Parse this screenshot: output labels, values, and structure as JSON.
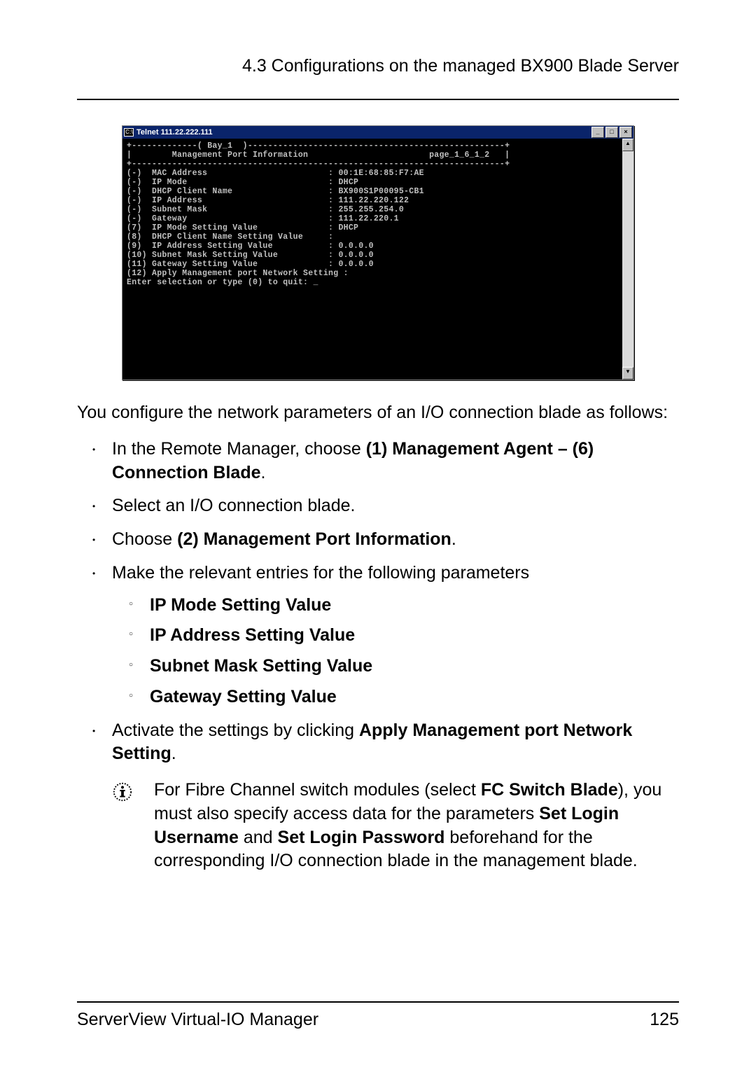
{
  "header": {
    "section": "4.3 Configurations on the managed BX900 Blade Server"
  },
  "telnet": {
    "title": "Telnet 111.22.222.111",
    "sysicon_label": "C:\\",
    "min_label": "_",
    "max_label": "□",
    "close_label": "×",
    "scroll_up": "▲",
    "scroll_down": "▼",
    "content": "+-------------( Bay_1  )---------------------------------------------------+\n|        Management Port Information                        page_1_6_1_2   |\n+--------------------------------------------------------------------------+\n(-)  MAC Address                        : 00:1E:68:85:F7:AE\n(-)  IP Mode                            : DHCP\n(-)  DHCP Client Name                   : BX900S1P00095-CB1\n(-)  IP Address                         : 111.22.220.122\n(-)  Subnet Mask                        : 255.255.254.0\n(-)  Gateway                            : 111.22.220.1\n(7)  IP Mode Setting Value              : DHCP\n(8)  DHCP Client Name Setting Value     :\n(9)  IP Address Setting Value           : 0.0.0.0\n(10) Subnet Mask Setting Value          : 0.0.0.0\n(11) Gateway Setting Value              : 0.0.0.0\n(12) Apply Management port Network Setting :\nEnter selection or type (0) to quit: _"
  },
  "chart_data": {
    "type": "table",
    "title": "Management Port Information",
    "page_ref": "page_1_6_1_2",
    "bay": "Bay_1",
    "rows": [
      {
        "key": "(-)",
        "label": "MAC Address",
        "value": "00:1E:68:85:F7:AE"
      },
      {
        "key": "(-)",
        "label": "IP Mode",
        "value": "DHCP"
      },
      {
        "key": "(-)",
        "label": "DHCP Client Name",
        "value": "BX900S1P00095-CB1"
      },
      {
        "key": "(-)",
        "label": "IP Address",
        "value": "111.22.220.122"
      },
      {
        "key": "(-)",
        "label": "Subnet Mask",
        "value": "255.255.254.0"
      },
      {
        "key": "(-)",
        "label": "Gateway",
        "value": "111.22.220.1"
      },
      {
        "key": "(7)",
        "label": "IP Mode Setting Value",
        "value": "DHCP"
      },
      {
        "key": "(8)",
        "label": "DHCP Client Name Setting Value",
        "value": ""
      },
      {
        "key": "(9)",
        "label": "IP Address Setting Value",
        "value": "0.0.0.0"
      },
      {
        "key": "(10)",
        "label": "Subnet Mask Setting Value",
        "value": "0.0.0.0"
      },
      {
        "key": "(11)",
        "label": "Gateway Setting Value",
        "value": "0.0.0.0"
      },
      {
        "key": "(12)",
        "label": "Apply Management port Network Setting",
        "value": ""
      }
    ],
    "prompt": "Enter selection or type (0) to quit: _"
  },
  "bodytext": {
    "intro": "You configure the network parameters of an I/O connection blade as follows:",
    "li1_pre": "In the Remote Manager, choose ",
    "li1_bold": "(1) Management Agent – (6) Connection Blade",
    "li1_post": ".",
    "li2": "Select an I/O connection blade.",
    "li3_pre": "Choose ",
    "li3_bold": "(2) Management Port Information",
    "li3_post": ".",
    "li4": "Make the relevant entries for the following parameters",
    "sub1": "IP Mode Setting Value",
    "sub2": "IP Address Setting Value",
    "sub3": "Subnet Mask Setting Value",
    "sub4": "Gateway Setting Value",
    "li5_pre": "Activate the settings by clicking ",
    "li5_bold": "Apply Management port Network Setting",
    "li5_post": ".",
    "info_pre": "For Fibre Channel switch modules (select ",
    "info_b1": "FC Switch Blade",
    "info_mid1": "), you must also specify access data for the parameters ",
    "info_b2": "Set Login Username",
    "info_mid2": " and ",
    "info_b3": "Set Login Password",
    "info_post": " beforehand for the corresponding I/O connection blade in the management blade."
  },
  "footer": {
    "left": "ServerView Virtual-IO Manager",
    "right": "125"
  }
}
